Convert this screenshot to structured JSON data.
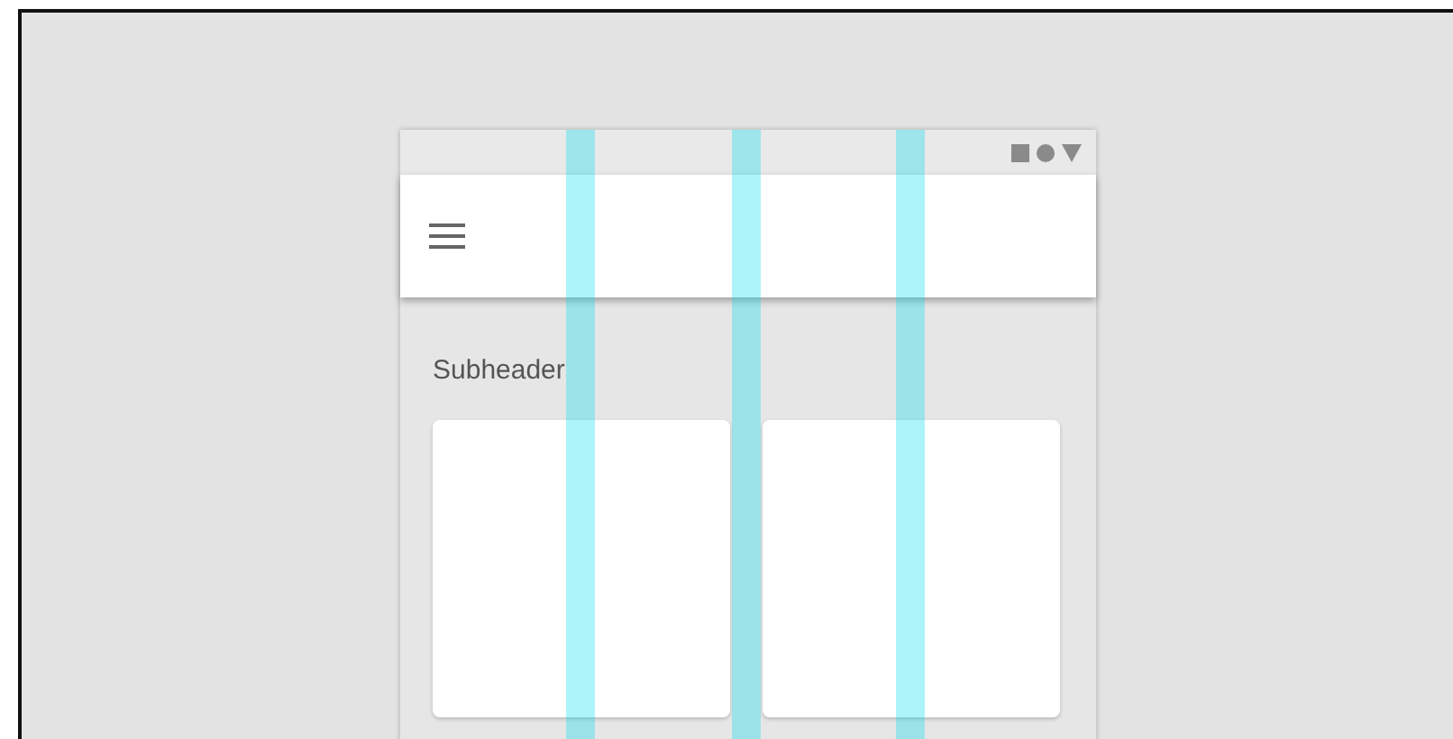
{
  "subheader": "Subheader",
  "cards": [
    {
      "kind": "card"
    },
    {
      "kind": "card"
    }
  ],
  "column_guides": [
    {
      "kind": "gutter"
    },
    {
      "kind": "gutter"
    },
    {
      "kind": "gutter"
    }
  ]
}
